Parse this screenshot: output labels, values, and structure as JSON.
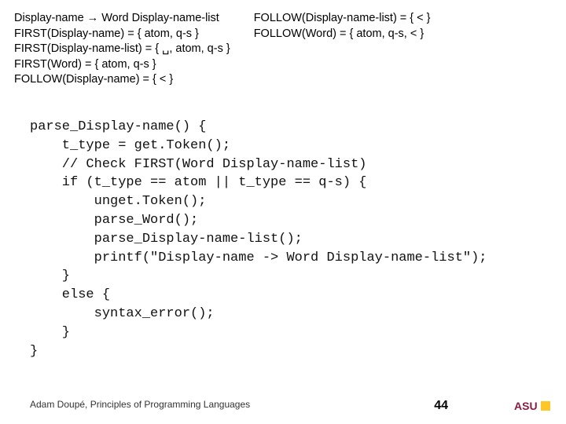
{
  "grammar": {
    "left": [
      "Display-name → Word Display-name-list",
      "FIRST(Display-name) = { atom, q-s }",
      "FIRST(Display-name-list) = { ␣, atom, q-s }",
      "FIRST(Word) = { atom, q-s }",
      "FOLLOW(Display-name) = { < }"
    ],
    "right": [
      "FOLLOW(Display-name-list) = { < }",
      "FOLLOW(Word) = { atom, q-s, < }"
    ]
  },
  "code": "parse_Display-name() {\n    t_type = get.Token();\n    // Check FIRST(Word Display-name-list)\n    if (t_type == atom || t_type == q-s) {\n        unget.Token();\n        parse_Word();\n        parse_Display-name-list();\n        printf(\"Display-name -> Word Display-name-list\");\n    }\n    else {\n        syntax_error();\n    }\n}",
  "footer": "Adam Doupé, Principles of Programming Languages",
  "page": "44",
  "logo_label": "ASU"
}
